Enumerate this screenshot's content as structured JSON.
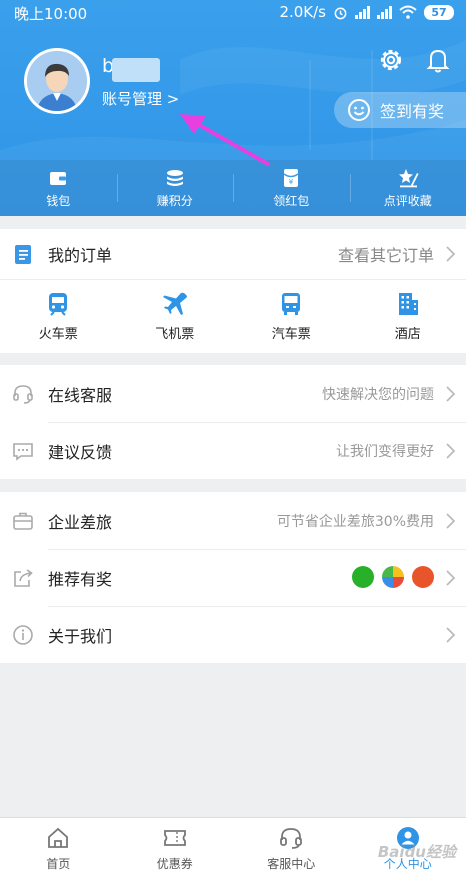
{
  "status_bar": {
    "time": "晚上10:00",
    "speed": "2.0K/s",
    "battery": "57"
  },
  "profile": {
    "username": "b",
    "account_link": "账号管理 >",
    "checkin_label": "签到有奖"
  },
  "quick_actions": [
    {
      "label": "钱包",
      "icon": "wallet-icon"
    },
    {
      "label": "赚积分",
      "icon": "coins-icon"
    },
    {
      "label": "领红包",
      "icon": "red-envelope-icon"
    },
    {
      "label": "点评收藏",
      "icon": "star-pen-icon"
    }
  ],
  "orders": {
    "title": "我的订单",
    "hint": "查看其它订单",
    "items": [
      {
        "label": "火车票",
        "icon": "train-icon"
      },
      {
        "label": "飞机票",
        "icon": "plane-icon"
      },
      {
        "label": "汽车票",
        "icon": "bus-icon"
      },
      {
        "label": "酒店",
        "icon": "hotel-icon"
      }
    ]
  },
  "service": [
    {
      "label": "在线客服",
      "hint": "快速解决您的问题",
      "icon": "headset-icon"
    },
    {
      "label": "建议反馈",
      "hint": "让我们变得更好",
      "icon": "feedback-icon"
    }
  ],
  "more": [
    {
      "label": "企业差旅",
      "hint": "可节省企业差旅30%费用",
      "icon": "briefcase-icon"
    },
    {
      "label": "推荐有奖",
      "hint": "",
      "icon": "share-icon"
    },
    {
      "label": "关于我们",
      "hint": "",
      "icon": "info-icon"
    }
  ],
  "tabs": [
    {
      "label": "首页",
      "icon": "home-icon"
    },
    {
      "label": "优惠券",
      "icon": "ticket-icon"
    },
    {
      "label": "客服中心",
      "icon": "headset-icon"
    },
    {
      "label": "个人中心",
      "icon": "person-icon"
    }
  ],
  "colors": {
    "brand": "#2f94e6",
    "annotation_arrow": "#e83fe0",
    "wechat": "#29b02b",
    "weibo": "#e8552a"
  },
  "watermark": "Baidu经验"
}
